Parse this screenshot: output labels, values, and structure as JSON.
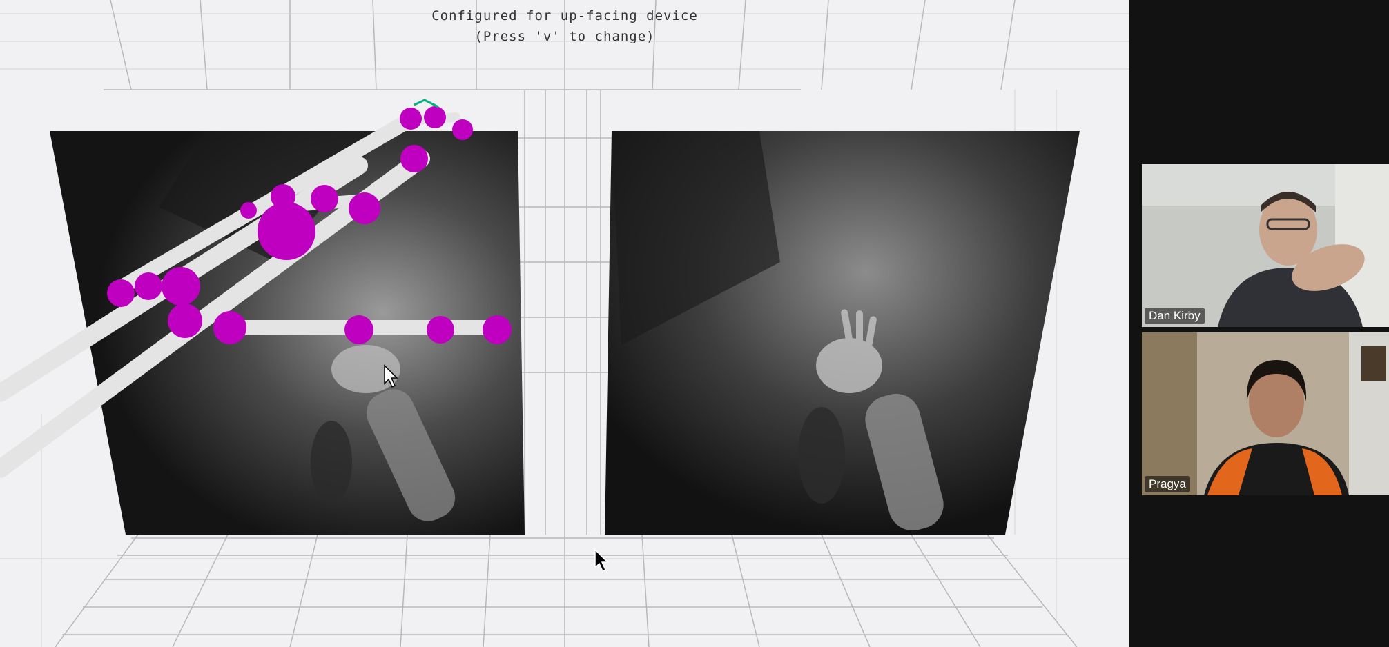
{
  "visualizer": {
    "status_line_1": "Configured for up-facing device",
    "status_line_2": "(Press 'v' to change)",
    "hand_model_color": "#cc00cc",
    "bone_color": "#e8e8e8",
    "grid_color": "#b5b5b8",
    "background_color": "#f1f1f3"
  },
  "participants": [
    {
      "name": "Dan Kirby"
    },
    {
      "name": "Pragya"
    }
  ],
  "icons": {
    "cursor_primary": "arrow-cursor-icon",
    "cursor_secondary": "arrow-cursor-icon"
  }
}
